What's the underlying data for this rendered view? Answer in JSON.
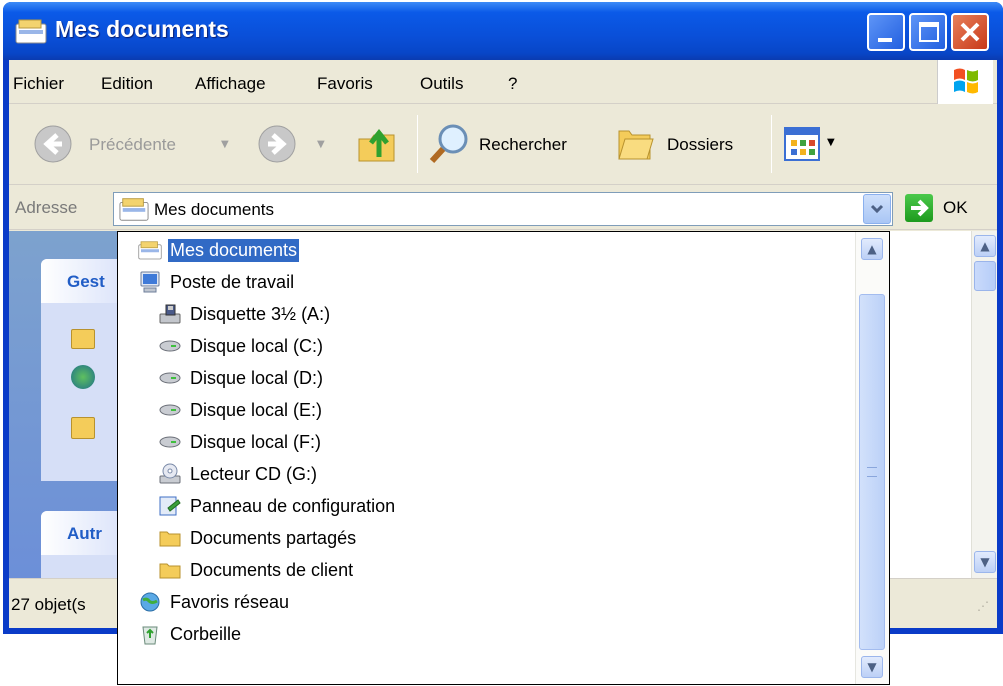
{
  "window": {
    "title": "Mes documents"
  },
  "menu": {
    "items": [
      "Fichier",
      "Edition",
      "Affichage",
      "Favoris",
      "Outils",
      "?"
    ]
  },
  "toolbar": {
    "back_label": "Précédente",
    "search_label": "Rechercher",
    "folders_label": "Dossiers"
  },
  "address": {
    "label": "Adresse",
    "value": "Mes documents",
    "go_label": "OK"
  },
  "taskpane": {
    "panel1_title": "Gest",
    "panel2_title": "Autr"
  },
  "status": {
    "text": "27 objet(s"
  },
  "dropdown": {
    "items": [
      {
        "label": "Mes documents",
        "icon": "my-documents-icon"
      },
      {
        "label": "Poste de travail",
        "icon": "my-computer-icon"
      },
      {
        "label": "Disquette 3½ (A:)",
        "icon": "floppy-drive-icon"
      },
      {
        "label": "Disque local (C:)",
        "icon": "hard-drive-icon"
      },
      {
        "label": "Disque local (D:)",
        "icon": "hard-drive-icon"
      },
      {
        "label": "Disque local (E:)",
        "icon": "hard-drive-icon"
      },
      {
        "label": "Disque local (F:)",
        "icon": "hard-drive-icon"
      },
      {
        "label": "Lecteur CD (G:)",
        "icon": "cd-drive-icon"
      },
      {
        "label": "Panneau de configuration",
        "icon": "control-panel-icon"
      },
      {
        "label": "Documents partagés",
        "icon": "folder-icon"
      },
      {
        "label": "Documents de client",
        "icon": "folder-icon"
      },
      {
        "label": "Favoris réseau",
        "icon": "network-places-icon"
      },
      {
        "label": "Corbeille",
        "icon": "recycle-bin-icon"
      }
    ],
    "selected": "Mes documents"
  },
  "colors": {
    "title_bar": "#0a4fd8",
    "selection": "#316ac5",
    "chrome": "#ece9d8"
  }
}
